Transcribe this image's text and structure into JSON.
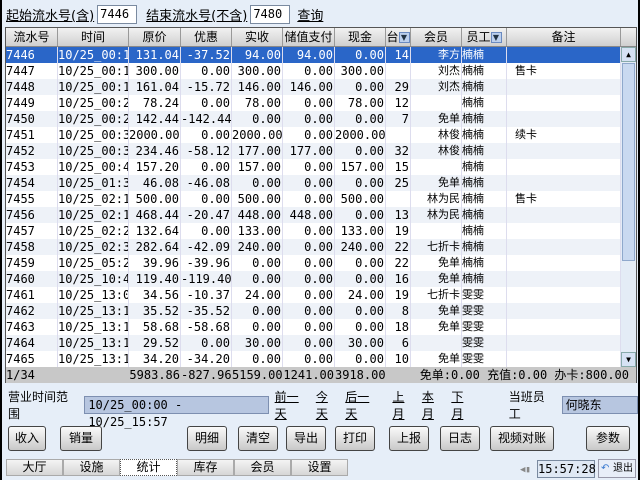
{
  "query": {
    "start_label": "起始流水号(含)",
    "start_value": "7446",
    "end_label": "结束流水号(不含)",
    "end_value": "7480",
    "query_label": "查询"
  },
  "table": {
    "headers": [
      "流水号",
      "时间",
      "原价",
      "优惠",
      "实收",
      "储值支付",
      "现金",
      "台",
      "会员",
      "员工",
      "备注"
    ],
    "rows": [
      [
        "7446",
        "10/25_00:10",
        "131.04",
        "-37.52",
        "94.00",
        "94.00",
        "0.00",
        "14",
        "李方",
        "楠楠",
        ""
      ],
      [
        "7447",
        "10/25_00:14",
        "300.00",
        "0.00",
        "300.00",
        "0.00",
        "300.00",
        "",
        "刘杰",
        "楠楠",
        "售卡"
      ],
      [
        "7448",
        "10/25_00:14",
        "161.04",
        "-15.72",
        "146.00",
        "146.00",
        "0.00",
        "29",
        "刘杰",
        "楠楠",
        ""
      ],
      [
        "7449",
        "10/25_00:26",
        "78.24",
        "0.00",
        "78.00",
        "0.00",
        "78.00",
        "12",
        "",
        "楠楠",
        ""
      ],
      [
        "7450",
        "10/25_00:27",
        "142.44",
        "-142.44",
        "0.00",
        "0.00",
        "0.00",
        "7",
        "免单",
        "楠楠",
        ""
      ],
      [
        "7451",
        "10/25_00:36",
        "2000.00",
        "0.00",
        "2000.00",
        "0.00",
        "2000.00",
        "",
        "林俊",
        "楠楠",
        "续卡"
      ],
      [
        "7452",
        "10/25_00:37",
        "234.46",
        "-58.12",
        "177.00",
        "177.00",
        "0.00",
        "32",
        "林俊",
        "楠楠",
        ""
      ],
      [
        "7453",
        "10/25_00:42",
        "157.20",
        "0.00",
        "157.00",
        "0.00",
        "157.00",
        "15",
        "",
        "楠楠",
        ""
      ],
      [
        "7454",
        "10/25_01:33",
        "46.08",
        "-46.08",
        "0.00",
        "0.00",
        "0.00",
        "25",
        "免单",
        "楠楠",
        ""
      ],
      [
        "7455",
        "10/25_02:14",
        "500.00",
        "0.00",
        "500.00",
        "0.00",
        "500.00",
        "",
        "林为民",
        "楠楠",
        "售卡"
      ],
      [
        "7456",
        "10/25_02:15",
        "468.44",
        "-20.47",
        "448.00",
        "448.00",
        "0.00",
        "13",
        "林为民",
        "楠楠",
        ""
      ],
      [
        "7457",
        "10/25_02:21",
        "132.64",
        "0.00",
        "133.00",
        "0.00",
        "133.00",
        "19",
        "",
        "楠楠",
        ""
      ],
      [
        "7458",
        "10/25_02:31",
        "282.64",
        "-42.09",
        "240.00",
        "0.00",
        "240.00",
        "22",
        "七折卡",
        "楠楠",
        ""
      ],
      [
        "7459",
        "10/25_05:25",
        "39.96",
        "-39.96",
        "0.00",
        "0.00",
        "0.00",
        "22",
        "免单",
        "楠楠",
        ""
      ],
      [
        "7460",
        "10/25_10:41",
        "119.40",
        "-119.40",
        "0.00",
        "0.00",
        "0.00",
        "16",
        "免单",
        "楠楠",
        ""
      ],
      [
        "7461",
        "10/25_13:05",
        "34.56",
        "-10.37",
        "24.00",
        "0.00",
        "24.00",
        "19",
        "七折卡",
        "雯雯",
        ""
      ],
      [
        "7462",
        "10/25_13:14",
        "35.52",
        "-35.52",
        "0.00",
        "0.00",
        "0.00",
        "8",
        "免单",
        "雯雯",
        ""
      ],
      [
        "7463",
        "10/25_13:15",
        "58.68",
        "-58.68",
        "0.00",
        "0.00",
        "0.00",
        "18",
        "免单",
        "雯雯",
        ""
      ],
      [
        "7464",
        "10/25_13:16",
        "29.52",
        "0.00",
        "30.00",
        "0.00",
        "30.00",
        "6",
        "",
        "雯雯",
        ""
      ],
      [
        "7465",
        "10/25_13:18",
        "34.20",
        "-34.20",
        "0.00",
        "0.00",
        "0.00",
        "10",
        "免单",
        "雯雯",
        ""
      ]
    ],
    "footer": {
      "page": "1/34",
      "original": "5983.86",
      "discount": "-827.96",
      "received": "5159.00",
      "stored": "1241.00",
      "cash": "3918.00",
      "summary": "免单:0.00 充值:0.00 办卡:800.00"
    }
  },
  "range": {
    "label": "营业时间范围",
    "value": "10/25_00:00 - 10/25_15:57",
    "links": [
      "前一天",
      "今天",
      "后一天",
      "上月",
      "本月",
      "下月"
    ],
    "staff_label": "当班员工",
    "staff_value": "何晓东"
  },
  "buttons": [
    "收入",
    "销量",
    "明细",
    "清空",
    "导出",
    "打印",
    "上报",
    "日志",
    "视频对账",
    "参数"
  ],
  "tabs": [
    "大厅",
    "设施",
    "统计",
    "库存",
    "会员",
    "设置"
  ],
  "active_tab": "统计",
  "clock": "15:57:28",
  "exit_label": "退出",
  "colors": {
    "selection": "#2a66c8",
    "background": "#e6eef8"
  }
}
